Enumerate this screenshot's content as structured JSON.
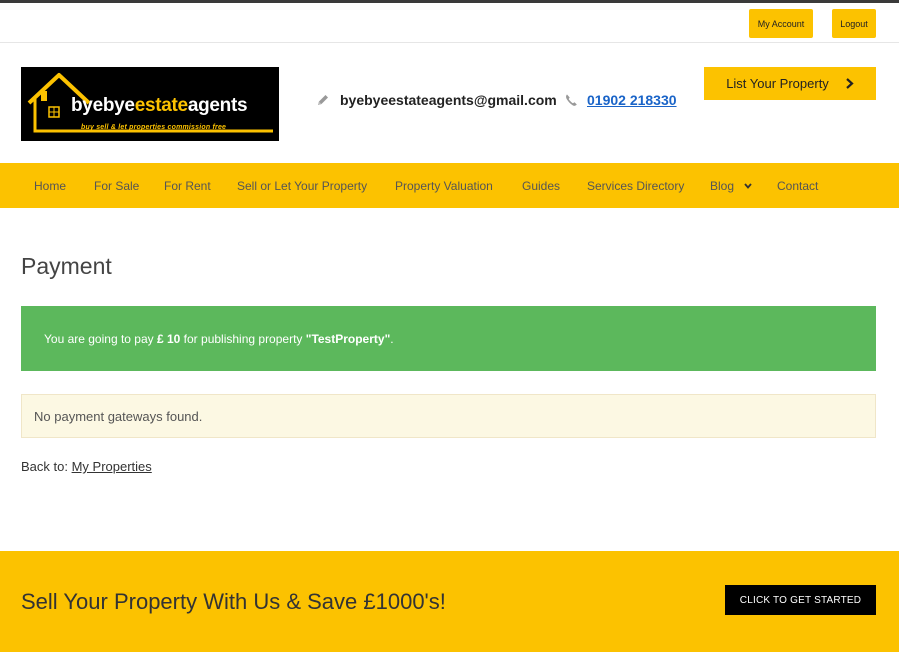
{
  "topbar": {
    "my_account": "My Account",
    "logout": "Logout"
  },
  "logo": {
    "main_a": "byebye",
    "main_b": "estate",
    "main_c": "agents",
    "tagline": "buy  sell & let properties commission free"
  },
  "contact": {
    "email": "byebyeestateagents@gmail.com",
    "phone": "01902 218330",
    "email_icon": "pencil-icon",
    "phone_icon": "phone-icon"
  },
  "header": {
    "list_property": "List Your Property"
  },
  "nav": {
    "items": [
      {
        "label": "Home"
      },
      {
        "label": "For Sale"
      },
      {
        "label": "For Rent"
      },
      {
        "label": "Sell or Let Your Property"
      },
      {
        "label": "Property Valuation"
      },
      {
        "label": "Guides"
      },
      {
        "label": "Services Directory"
      },
      {
        "label": "Blog"
      },
      {
        "label": "Contact"
      }
    ]
  },
  "main": {
    "title": "Payment",
    "success": {
      "prefix": "You are going to pay ",
      "amount": "£ 10",
      "middle": " for publishing property ",
      "property": "\"TestProperty\"",
      "suffix": "."
    },
    "warning": "No payment gateways found.",
    "back_label": "Back to: ",
    "back_link": "My Properties"
  },
  "footer": {
    "tagline": "Sell Your Property With Us & Save £1000's!",
    "cta": "CLICK TO GET STARTED"
  },
  "colors": {
    "accent": "#fcc200",
    "success": "#5cb85c",
    "warning_bg": "#fcf8e3",
    "link": "#1a64c8"
  }
}
